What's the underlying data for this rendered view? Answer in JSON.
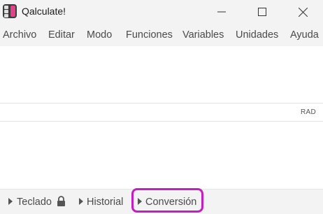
{
  "window": {
    "title": "Qalculate!",
    "icons": {
      "app": "qalculate-app-icon",
      "minimize": "minimize-icon",
      "maximize": "maximize-icon",
      "close": "close-icon"
    }
  },
  "menubar": {
    "items": [
      "Archivo",
      "Editar",
      "Modo",
      "Funciones",
      "Variables",
      "Unidades",
      "Ayuda"
    ]
  },
  "status": {
    "angle_unit": "RAD"
  },
  "bottombar": {
    "keypad": {
      "label": "Teclado",
      "icon": "lock-icon"
    },
    "history": {
      "label": "Historial"
    },
    "conversion": {
      "label": "Conversión",
      "highlighted": true
    }
  },
  "colors": {
    "highlight": "#c21fc2",
    "chrome": "#f3f3f3"
  }
}
